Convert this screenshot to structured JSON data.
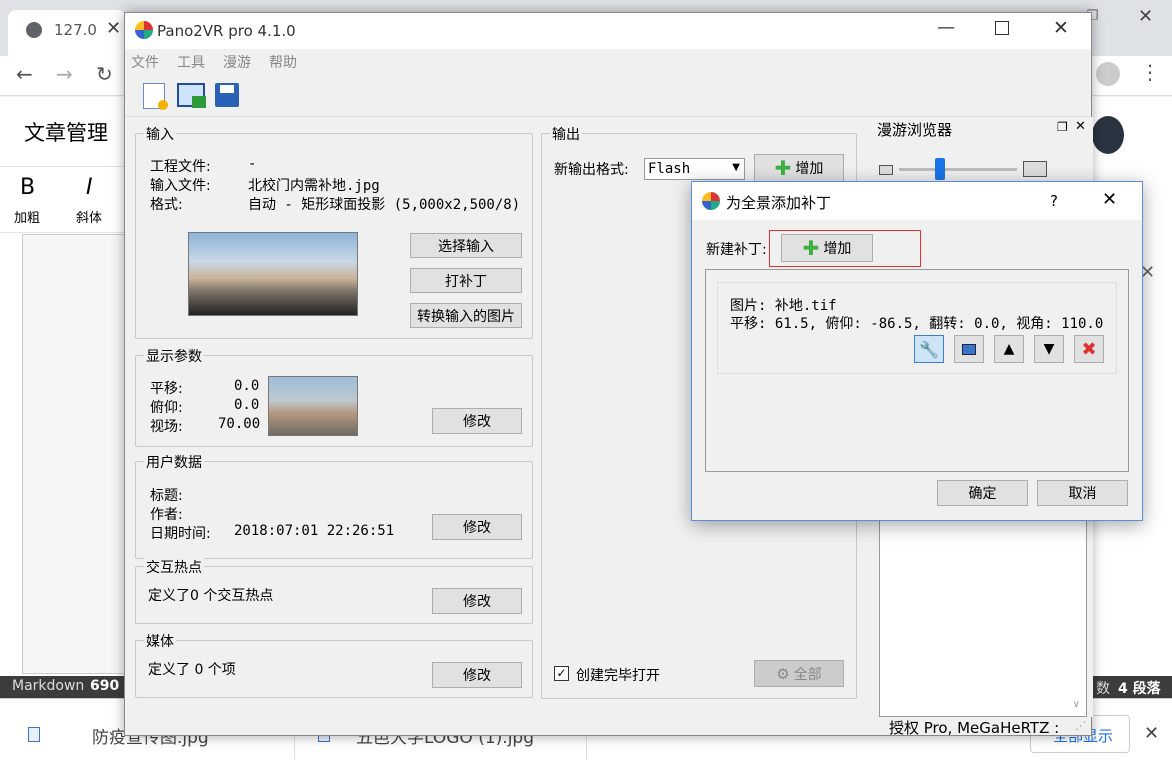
{
  "browser": {
    "tab_title": "127.0",
    "editor_back_title": "文章管理",
    "bold_label": "加粗",
    "italic_label": "斜体",
    "status_left": "Markdown",
    "status_count": "690",
    "status_right_label": "数",
    "status_paragraphs": "4 段落",
    "downloads": [
      "防疫宣传图.jpg",
      "五邑大学LOGO (1).jpg"
    ],
    "show_all": "全部显示"
  },
  "main": {
    "title": "Pano2VR pro 4.1.0",
    "menu": [
      "文件",
      "工具",
      "漫游",
      "帮助"
    ],
    "input_group": {
      "title": "输入",
      "project_label": "工程文件:",
      "project_value": "-",
      "input_label": "输入文件:",
      "input_value": "北校门内需补地.jpg",
      "format_label": "格式:",
      "format_value": "自动 - 矩形球面投影 (5,000x2,500/8)",
      "btn_select": "选择输入",
      "btn_patch": "打补丁",
      "btn_convert": "转换输入的图片"
    },
    "display_group": {
      "title": "显示参数",
      "pan_label": "平移:",
      "pan_value": "0.0",
      "tilt_label": "俯仰:",
      "tilt_value": "0.0",
      "fov_label": "视场:",
      "fov_value": "70.00",
      "btn_modify": "修改"
    },
    "user_group": {
      "title": "用户数据",
      "title_label": "标题:",
      "author_label": "作者:",
      "date_label": "日期时间:",
      "date_value": "2018:07:01 22:26:51",
      "btn_modify": "修改"
    },
    "hotspot_group": {
      "title": "交互热点",
      "text": "定义了0 个交互热点",
      "btn_modify": "修改"
    },
    "media_group": {
      "title": "媒体",
      "text": "定义了 0 个项",
      "btn_modify": "修改"
    },
    "output_group": {
      "title": "输出",
      "new_format_label": "新输出格式:",
      "format_selected": "Flash",
      "btn_add": "增加",
      "open_after_label": "创建完毕打开",
      "open_after_checked": true,
      "btn_all": "全部"
    },
    "dock": {
      "title": "漫游浏览器"
    },
    "status": "授权 Pro, MeGaHeRTZ :"
  },
  "dialog": {
    "title": "为全景添加补丁",
    "help": "?",
    "new_patch_label": "新建补丁:",
    "btn_add": "增加",
    "patch_image_line": "图片: 补地.tif",
    "patch_params_line": "平移: 61.5, 俯仰: -86.5, 翻转: 0.0, 视角: 110.0",
    "btn_ok": "确定",
    "btn_cancel": "取消"
  },
  "colors": {
    "accent": "#1a73e8",
    "highlight_red": "#e03030",
    "dialog_border": "#5a8ed6",
    "add_green": "#3cb043"
  }
}
